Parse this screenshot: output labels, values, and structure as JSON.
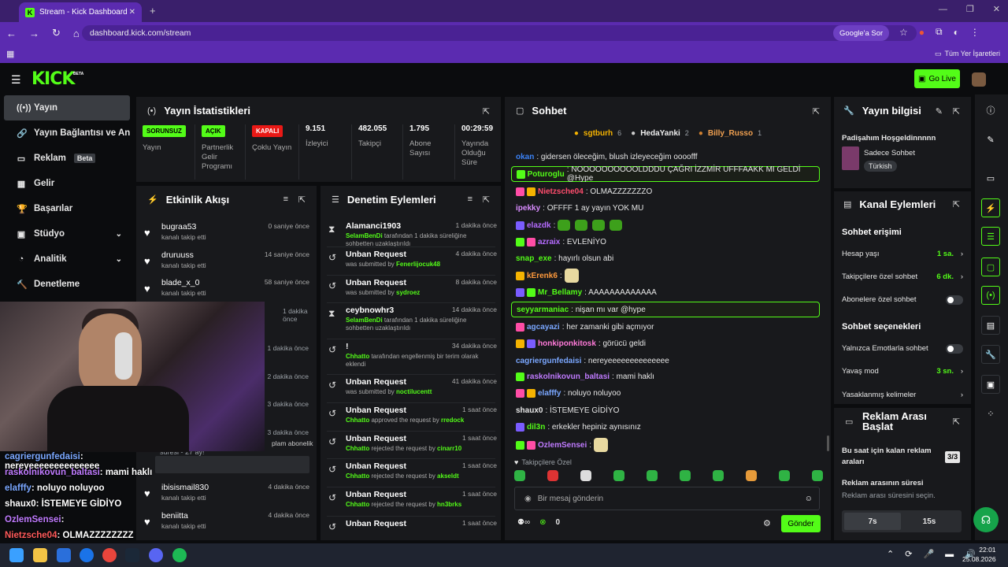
{
  "browser": {
    "tab_title": "Stream - Kick Dashboard",
    "url": "dashboard.kick.com/stream",
    "google_label": "Google'a Sor",
    "bookmarks_label": "Tüm Yer İşaretleri"
  },
  "header": {
    "logo": "KICK",
    "beta": "BETA",
    "go_live": "Go Live"
  },
  "nav": [
    {
      "label": "Yayın",
      "icon": "broadcast-icon"
    },
    {
      "label": "Yayın Bağlantısı ve Anahtar",
      "icon": "link-icon"
    },
    {
      "label": "Reklam",
      "icon": "ad-icon",
      "badge": "Beta"
    },
    {
      "label": "Gelir",
      "icon": "revenue-icon"
    },
    {
      "label": "Başarılar",
      "icon": "trophy-icon"
    },
    {
      "label": "Stüdyo",
      "icon": "studio-icon"
    },
    {
      "label": "Analitik",
      "icon": "analytics-icon"
    },
    {
      "label": "Denetleme",
      "icon": "moderation-icon"
    }
  ],
  "stats": {
    "title": "Yayın İstatistikleri",
    "cols": [
      {
        "badge": "SORUNSUZ",
        "label": "Yayın"
      },
      {
        "badge": "AÇIK",
        "label": "Partnerlik Gelir Programı"
      },
      {
        "badge": "KAPALI",
        "label": "Çoklu Yayın"
      },
      {
        "value": "9.151",
        "label": "İzleyici"
      },
      {
        "value": "482.055",
        "label": "Takipçi"
      },
      {
        "value": "1.795",
        "label": "Abone Sayısı"
      },
      {
        "value": "00:29:59",
        "label": "Yayında Olduğu Süre"
      }
    ]
  },
  "activity": {
    "title": "Etkinlik Akışı",
    "rows": [
      {
        "name": "bugraa53",
        "sub": "kanalı takip etti",
        "time": "0 saniye önce"
      },
      {
        "name": "druruuss",
        "sub": "kanalı takip etti",
        "time": "14 saniye önce"
      },
      {
        "name": "blade_x_0",
        "sub": "kanalı takip etti",
        "time": "58 saniye önce"
      }
    ],
    "partial_times": [
      "1 dakika önce",
      "1 dakika önce",
      "2 dakika önce",
      "3 dakika önce",
      "3 dakika önce"
    ],
    "partial_sub": "plam abonelik",
    "partial_sub2": "süresi - 27 ay!",
    "rows2": [
      {
        "name": "ibisismail830",
        "sub": "kanalı takip etti",
        "time": "4 dakika önce"
      },
      {
        "name": "beniitta",
        "sub": "kanalı takip etti",
        "time": "4 dakika önce"
      }
    ]
  },
  "mod": {
    "title": "Denetim Eylemleri",
    "rows": [
      {
        "title": "Alamanci1903",
        "user": "SelamBenDi",
        "desc": " tarafından 1 dakika süreliğine sohbetten uzaklaştırıldı",
        "time": "1 dakika önce",
        "icon": "hourglass-icon"
      },
      {
        "title": "Unban Request",
        "desc": "was submitted by ",
        "user": "Fenerlijocuk48",
        "time": "4 dakika önce",
        "icon": "history-icon",
        "after": true
      },
      {
        "title": "Unban Request",
        "desc": "was submitted by ",
        "user": "sydroez",
        "time": "8 dakika önce",
        "icon": "history-icon",
        "after": true
      },
      {
        "title": "ceybnowhr3",
        "user": "SelamBenDi",
        "desc": " tarafından 1 dakika süreliğine sohbetten uzaklaştırıldı",
        "time": "14 dakika önce",
        "icon": "hourglass-icon"
      },
      {
        "title": "!",
        "user": "Chhatto",
        "desc": " tarafından engellenmiş bir terim olarak eklendi",
        "time": "34 dakika önce",
        "icon": "history-icon"
      },
      {
        "title": "Unban Request",
        "desc": "was submitted by ",
        "user": "noctilucentt",
        "time": "41 dakika önce",
        "icon": "history-icon",
        "after": true
      },
      {
        "title": "Unban Request",
        "user": "Chhatto",
        "desc": " approved the request by ",
        "user2": "rredock",
        "time": "1 saat önce",
        "icon": "history-icon"
      },
      {
        "title": "Unban Request",
        "user": "Chhatto",
        "desc": " rejected the request by ",
        "user2": "cinarr10",
        "time": "1 saat önce",
        "icon": "history-icon"
      },
      {
        "title": "Unban Request",
        "user": "Chhatto",
        "desc": " rejected the request by ",
        "user2": "akseldt",
        "time": "1 saat önce",
        "icon": "history-icon"
      },
      {
        "title": "Unban Request",
        "user": "Chhatto",
        "desc": " rejected the request by ",
        "user2": "hn3brks",
        "time": "1 saat önce",
        "icon": "history-icon"
      },
      {
        "title": "Unban Request",
        "time": "1 saat önce",
        "icon": "history-icon"
      }
    ]
  },
  "overlay_chat": [
    {
      "u": "cagriergunfedaisi",
      "t": ": nereyeeeeeeeeeeeeee",
      "c": "#7aa7ff"
    },
    {
      "u": "raskolnikovun_baltasi",
      "t": ": mami haklı",
      "c": "#c07bff"
    },
    {
      "u": "elafffy",
      "t": ": noluyo noluyoo",
      "c": "#7aa7ff"
    },
    {
      "u": "shaux0",
      "t": ": İSTEMEYE GİDİYO",
      "c": "#fff"
    },
    {
      "u": "OzlemSensei",
      "t": ":",
      "c": "#c07bff"
    },
    {
      "u": "Nietzsche04",
      "t": ": OLMAZZZZZZZZ",
      "c": "#ff5a5a"
    }
  ],
  "chat": {
    "title": "Sohbet",
    "top": [
      {
        "name": "sgtburh",
        "n": "6"
      },
      {
        "name": "HedaYanki",
        "n": "2"
      },
      {
        "name": "Billy_Russo",
        "n": "1"
      }
    ],
    "messages": [
      {
        "u": "okan",
        "t": ": gidersen öleceğim, blush izleyeceğim oooofff",
        "c": "#3b82f6"
      },
      {
        "u": "Poturoglu",
        "t": ": NOOOOOOOOOOLDDDU ÇAĞRI İZZMİR UFFFAAKK MI GELDİ @Hype",
        "c": "#53fc18",
        "hl": true
      },
      {
        "u": "Nietzsche04",
        "t": ": OLMAZZZZZZZO",
        "c": "#ff4d6d"
      },
      {
        "u": "ipekky",
        "t": ": OFFFF 1 ay yayın YOK MU",
        "c": "#d98cff"
      },
      {
        "u": "elazdk",
        "t": ":",
        "c": "#b56bff",
        "emotes": 4
      },
      {
        "u": "azraix",
        "t": ": EVLENİYO",
        "c": "#b56bff"
      },
      {
        "u": "snap_exe",
        "t": ": hayırlı olsun abi",
        "c": "#53fc18"
      },
      {
        "u": "kErenk6",
        "t": ":",
        "c": "#ff9a3c"
      },
      {
        "u": "Mr_Bellamy",
        "t": ": AAAAAAAAAAAAA",
        "c": "#53fc18"
      },
      {
        "u": "seyyarmaniac",
        "t": ": nişan mı var @hype",
        "c": "#53fc18",
        "hl": true
      },
      {
        "u": "agcayazi",
        "t": ": her zamanki gibi açmıyor",
        "c": "#7aa7ff"
      },
      {
        "u": "honkiponkitosk",
        "t": ": görücü geldi",
        "c": "#ff7ad9"
      },
      {
        "u": "cagriergunfedaisi",
        "t": ": nereyeeeeeeeeeeeeee",
        "c": "#7aa7ff"
      },
      {
        "u": "raskolnikovun_baltasi",
        "t": ": mami haklı",
        "c": "#c07bff"
      },
      {
        "u": "elafffy",
        "t": ": noluyo noluyoo",
        "c": "#7aa7ff"
      },
      {
        "u": "shaux0",
        "t": ": İSTEMEYE GİDİYO",
        "c": "#e6e6e6"
      },
      {
        "u": "dil3n",
        "t": ": erkekler hepiniz aynısınız",
        "c": "#53fc18"
      },
      {
        "u": "OzlemSensei",
        "t": ":",
        "c": "#c07bff"
      }
    ],
    "followers_only": "Takipçilere Özel",
    "placeholder": "Bir mesaj gönderin",
    "count": "0",
    "send": "Gönder"
  },
  "info": {
    "title": "Yayın bilgisi",
    "stream_title": "Padişahım Hoşgeldinnnnn",
    "category": "Sadece Sohbet",
    "tag": "Türkish"
  },
  "channel": {
    "title": "Kanal Eylemleri",
    "chat_access": "Sohbet erişimi",
    "account_age": "Hesap yaşı",
    "account_age_val": "1 sa.",
    "followers_chat": "Takipçilere özel sohbet",
    "followers_val": "6 dk.",
    "subs_chat": "Abonelere özel sohbet",
    "chat_options": "Sohbet seçenekleri",
    "emotes_only": "Yalnızca Emotlarla sohbet",
    "slow_mode": "Yavaş mod",
    "slow_val": "3 sn.",
    "banned_words": "Yasaklanmış kelimeler"
  },
  "adbreak": {
    "title": "Reklam Arası Başlat",
    "remaining": "Bu saat için kalan reklam araları",
    "remaining_val": "3/3",
    "duration": "Reklam arasının süresi",
    "duration_hint": "Reklam arası süresini seçin.",
    "opt1": "7s",
    "opt2": "15s"
  },
  "taskbar": {
    "time": "22:01",
    "date": "25.08.2026"
  }
}
